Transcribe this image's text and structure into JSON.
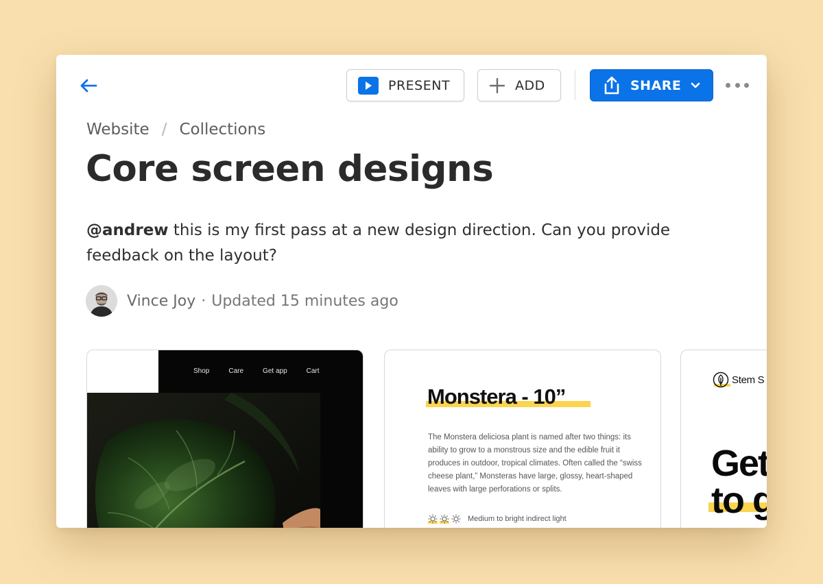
{
  "toolbar": {
    "present_label": "PRESENT",
    "add_label": "ADD",
    "share_label": "SHARE"
  },
  "breadcrumb": {
    "items": [
      "Website",
      "Collections"
    ],
    "separator": "/"
  },
  "page": {
    "title": "Core screen designs",
    "mention": "@andrew",
    "description": " this is my first pass at a new design direction. Can you provide feedback on the layout?",
    "author": "Vince Joy",
    "separator": "·",
    "updated": "Updated 15 minutes ago"
  },
  "cards": {
    "card1": {
      "nav": [
        "Shop",
        "Care",
        "Get app",
        "Cart"
      ]
    },
    "card2": {
      "title": "Monstera - 10”",
      "description": "The Monstera deliciosa plant is named after two things: its ability to grow to a monstrous size and the edible fruit it produces in outdoor, tropical climates. Often called the “swiss cheese plant,” Monsteras have large, glossy, heart-shaped leaves with large perforations or splits.",
      "light": "Medium to bright indirect light"
    },
    "card3": {
      "brand": "Stem S",
      "headline": "Get\nto g"
    }
  },
  "icons": {
    "back": "arrow-left-icon",
    "present": "play-icon",
    "add": "plus-icon",
    "share": "share-upload-icon",
    "dropdown": "chevron-down-icon",
    "more": "more-horizontal-icon",
    "sun": "sun-icon",
    "leaf": "leaf-logo-icon"
  },
  "colors": {
    "accent": "#0b73e8",
    "highlight": "#fbd450",
    "background": "#f9dfae"
  }
}
